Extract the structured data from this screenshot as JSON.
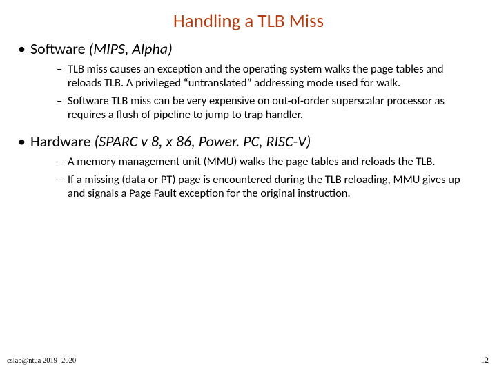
{
  "title": "Handling a TLB Miss",
  "sections": [
    {
      "label": "Software",
      "paren": " (MIPS, Alpha)",
      "subs": [
        "TLB miss causes an exception and the operating system walks the page tables and reloads TLB. A privileged “untranslated”  addressing mode used for walk.",
        "Software TLB miss can be very expensive on out-of-order superscalar processor as requires a flush of pipeline to jump to trap handler."
      ]
    },
    {
      "label": "Hardware",
      "paren": " (SPARC v 8, x 86, Power. PC, RISC-V)",
      "subs": [
        "A memory management unit (MMU) walks the page tables and reloads the TLB.",
        "If a missing (data or PT) page is encountered during the TLB reloading, MMU gives up and signals a Page Fault exception for the original instruction."
      ]
    }
  ],
  "footer": {
    "left": "cslab@ntua 2019 -2020",
    "right": "12"
  }
}
